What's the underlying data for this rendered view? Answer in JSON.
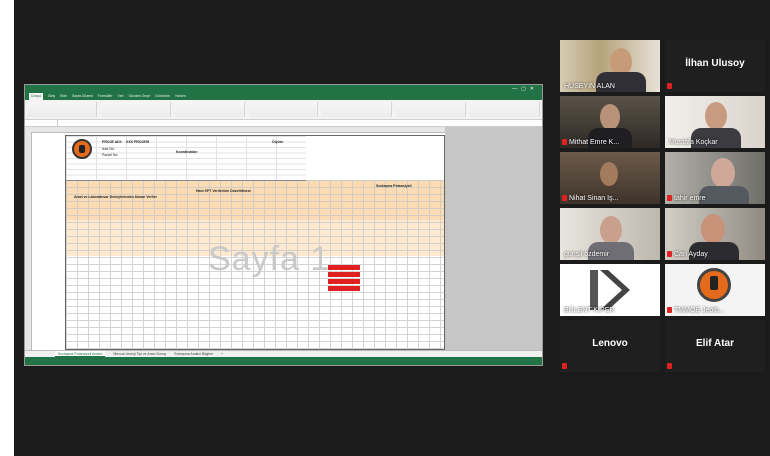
{
  "excel": {
    "ribbon_tabs": [
      "Dosya",
      "Giriş",
      "Ekle",
      "Sayfa Düzeni",
      "Formüller",
      "Veri",
      "Gözden Geçir",
      "Görünüm",
      "Yardım"
    ],
    "header": {
      "proje_adi_label": "PROJE ADI:",
      "proje_adi_value": "XXX PROJESİ",
      "ada_no": "Ada No:",
      "parsel_no": "Parsel No:",
      "koordinatlar": "Koordinatlar:",
      "olcum": "Ölçüm"
    },
    "section_title_left": "Arazi ve Laboratuvar Deneylerinden Alınan Veriler",
    "section_title_mid": "Ham SPT Verilerinin Düzeltilmesi",
    "section_title_right": "Sıvılaşma Potansiyeli",
    "watermark": "Sayfa 1",
    "red_label": "Sıvılaşma Beklenir",
    "sheet_tabs": [
      "Sıvılaşma Potansiyeli Analizi",
      "Mevcut Jeoloji Tipi ve Arazi Sonuç",
      "Sıvılaşma Analizi Bilgileri",
      "+"
    ]
  },
  "participants": [
    {
      "name": "HUSEYIN ALAN",
      "muted": false
    },
    {
      "name": "İlhan Ulusoy",
      "muted": true,
      "text_only": true
    },
    {
      "name": "Mithat Emre K...",
      "muted": true
    },
    {
      "name": "Mustafa Koçkar",
      "muted": false,
      "active_speaker": true
    },
    {
      "name": "Nihat Sinan Iş...",
      "muted": true
    },
    {
      "name": "tahir emre",
      "muted": true
    },
    {
      "name": "gunşli özdemir",
      "muted": false
    },
    {
      "name": "Can Ayday",
      "muted": true
    },
    {
      "name": "BÜLENT KIPER",
      "muted": false
    },
    {
      "name": "TMMOB Jeolo...",
      "muted": true
    },
    {
      "name": "Lenovo",
      "muted": true,
      "text_only": true
    },
    {
      "name": "Elif Atar",
      "muted": true,
      "text_only": true
    }
  ]
}
